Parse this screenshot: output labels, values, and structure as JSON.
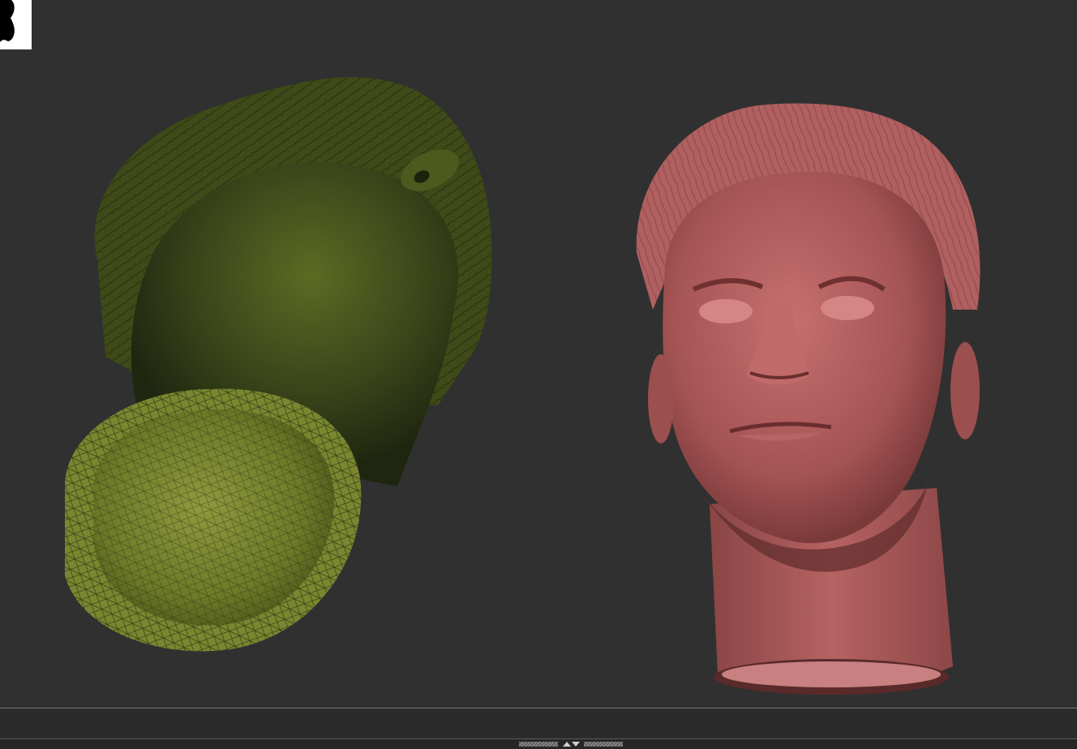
{
  "app": {
    "viewport_background": "#303030",
    "divider_color": "#767676"
  },
  "thumbnail": {
    "icon": "model-silhouette-thumbnail-icon",
    "background": "#ffffff"
  },
  "models": [
    {
      "name": "head-mesh-green-wireframe",
      "color": "#5a6a22",
      "icon": "sculpt-head-underside-icon"
    },
    {
      "name": "head-mesh-red",
      "color": "#b85e5e",
      "icon": "sculpt-head-front-icon"
    }
  ],
  "tray": {
    "toggle_icon": "up-down-arrows-icon"
  }
}
